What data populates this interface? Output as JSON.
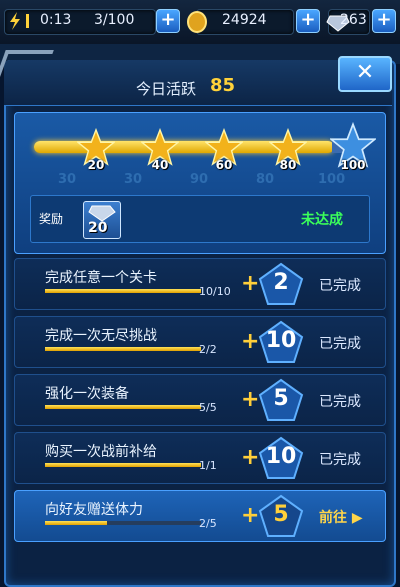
{
  "statusbar": {
    "time": "0:13",
    "energy": "3/100",
    "gold": "24924",
    "gems": "263"
  },
  "header": {
    "title_label": "今日活跃",
    "title_value": "85"
  },
  "progress": {
    "value": 85,
    "milestones": [
      "20",
      "40",
      "60",
      "80",
      "100"
    ],
    "ghost_labels": [
      "30",
      "30",
      "90",
      "80",
      "100"
    ],
    "reward_label": "奖励",
    "reward_amount": "20",
    "reward_status": "未达成"
  },
  "tasks": [
    {
      "name": "完成任意一个关卡",
      "count": "10/10",
      "progress": 1.0,
      "reward": "2",
      "status": "已完成"
    },
    {
      "name": "完成一次无尽挑战",
      "count": "2/2",
      "progress": 1.0,
      "reward": "10",
      "status": "已完成"
    },
    {
      "name": "强化一次装备",
      "count": "5/5",
      "progress": 1.0,
      "reward": "5",
      "status": "已完成"
    },
    {
      "name": "购买一次战前补给",
      "count": "1/1",
      "progress": 1.0,
      "reward": "10",
      "status": "已完成"
    },
    {
      "name": "向好友赠送体力",
      "count": "2/5",
      "progress": 0.4,
      "reward": "5",
      "status": "前往"
    }
  ],
  "close_label": "✕",
  "plus_symbol": "+",
  "colors": {
    "accent": "#ffcf3a",
    "green": "#3bff5a",
    "panel": "#0b2243"
  }
}
